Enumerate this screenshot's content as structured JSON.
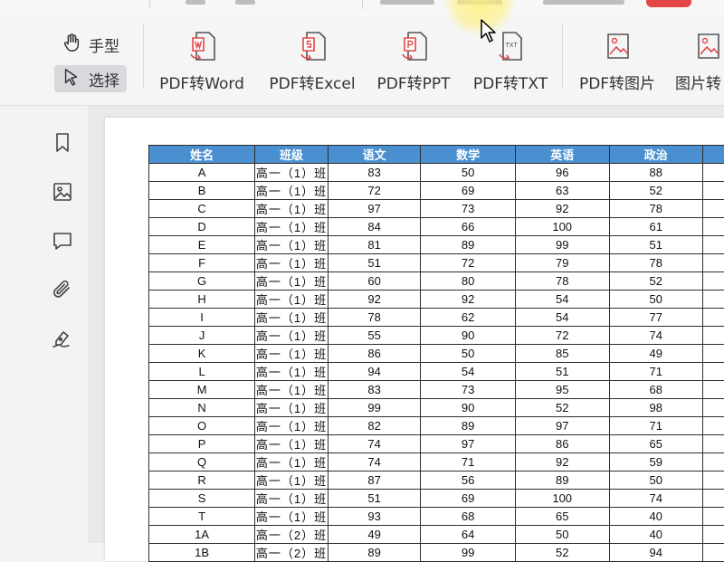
{
  "toolbar": {
    "modes": [
      {
        "label": "手型",
        "icon": "hand-icon",
        "active": false
      },
      {
        "label": "选择",
        "icon": "arrow-cursor-icon",
        "active": true
      }
    ],
    "tools": [
      {
        "label": "PDF转Word",
        "icon": "pdf-to-word-icon"
      },
      {
        "label": "PDF转Excel",
        "icon": "pdf-to-excel-icon"
      },
      {
        "label": "PDF转PPT",
        "icon": "pdf-to-ppt-icon"
      },
      {
        "label": "PDF转TXT",
        "icon": "pdf-to-txt-icon"
      },
      {
        "label": "PDF转图片",
        "icon": "pdf-to-image-icon"
      },
      {
        "label": "图片转",
        "icon": "image-to-pdf-icon"
      }
    ]
  },
  "sidebar": {
    "items": [
      "bookmark-icon",
      "image-icon",
      "comment-icon",
      "paperclip-icon",
      "signature-pen-icon"
    ]
  },
  "accent_color": "#4a90d0",
  "table": {
    "headers": [
      "姓名",
      "班级",
      "语文",
      "数学",
      "英语",
      "政治"
    ],
    "rows": [
      [
        "A",
        "高一（1）班",
        "83",
        "50",
        "96",
        "88"
      ],
      [
        "B",
        "高一（1）班",
        "72",
        "69",
        "63",
        "52"
      ],
      [
        "C",
        "高一（1）班",
        "97",
        "73",
        "92",
        "78"
      ],
      [
        "D",
        "高一（1）班",
        "84",
        "66",
        "100",
        "61"
      ],
      [
        "E",
        "高一（1）班",
        "81",
        "89",
        "99",
        "51"
      ],
      [
        "F",
        "高一（1）班",
        "51",
        "72",
        "79",
        "78"
      ],
      [
        "G",
        "高一（1）班",
        "60",
        "80",
        "78",
        "52"
      ],
      [
        "H",
        "高一（1）班",
        "92",
        "92",
        "54",
        "50"
      ],
      [
        "I",
        "高一（1）班",
        "78",
        "62",
        "54",
        "77"
      ],
      [
        "J",
        "高一（1）班",
        "55",
        "90",
        "72",
        "74"
      ],
      [
        "K",
        "高一（1）班",
        "86",
        "50",
        "85",
        "49"
      ],
      [
        "L",
        "高一（1）班",
        "94",
        "54",
        "51",
        "71"
      ],
      [
        "M",
        "高一（1）班",
        "83",
        "73",
        "95",
        "68"
      ],
      [
        "N",
        "高一（1）班",
        "99",
        "90",
        "52",
        "98"
      ],
      [
        "O",
        "高一（1）班",
        "82",
        "89",
        "97",
        "71"
      ],
      [
        "P",
        "高一（1）班",
        "74",
        "97",
        "86",
        "65"
      ],
      [
        "Q",
        "高一（1）班",
        "74",
        "71",
        "92",
        "59"
      ],
      [
        "R",
        "高一（1）班",
        "87",
        "56",
        "89",
        "50"
      ],
      [
        "S",
        "高一（1）班",
        "51",
        "69",
        "100",
        "74"
      ],
      [
        "T",
        "高一（1）班",
        "93",
        "68",
        "65",
        "40"
      ],
      [
        "1A",
        "高一（2）班",
        "49",
        "64",
        "50",
        "40"
      ],
      [
        "1B",
        "高一（2）班",
        "89",
        "99",
        "52",
        "94"
      ]
    ]
  }
}
